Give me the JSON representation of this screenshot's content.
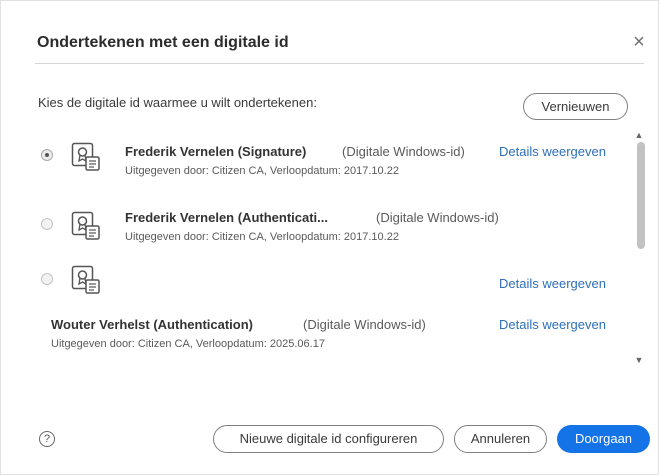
{
  "dialog": {
    "title": "Ondertekenen met een digitale id",
    "close_label": "×",
    "prompt": "Kies de digitale id waarmee u wilt ondertekenen:",
    "refresh_label": "Vernieuwen"
  },
  "ids": [
    {
      "name": "Frederik Vernelen (Signature)",
      "type": "(Digitale Windows-id)",
      "issued": "Uitgegeven door: Citizen CA, Verloopdatum: 2017.10.22",
      "details": "Details weergeven",
      "selected": true
    },
    {
      "name": "Frederik Vernelen (Authenticati...",
      "type": "(Digitale Windows-id)",
      "issued": "Uitgegeven door: Citizen CA, Verloopdatum: 2017.10.22",
      "details": "",
      "selected": false
    },
    {
      "name": "",
      "type": "",
      "issued": "",
      "details": "Details weergeven",
      "selected": false
    },
    {
      "name": "Wouter Verhelst (Authentication)",
      "type": "(Digitale Windows-id)",
      "issued": "Uitgegeven door: Citizen CA, Verloopdatum: 2025.06.17",
      "details": "Details weergeven",
      "selected": false
    }
  ],
  "footer": {
    "help_label": "?",
    "configure_label": "Nieuwe digitale id configureren",
    "cancel_label": "Annuleren",
    "continue_label": "Doorgaan"
  },
  "colors": {
    "accent": "#1473e6",
    "link": "#2d6fb8"
  },
  "icons": {
    "certificate": "certificate-icon",
    "close": "close-icon",
    "help": "help-icon"
  }
}
